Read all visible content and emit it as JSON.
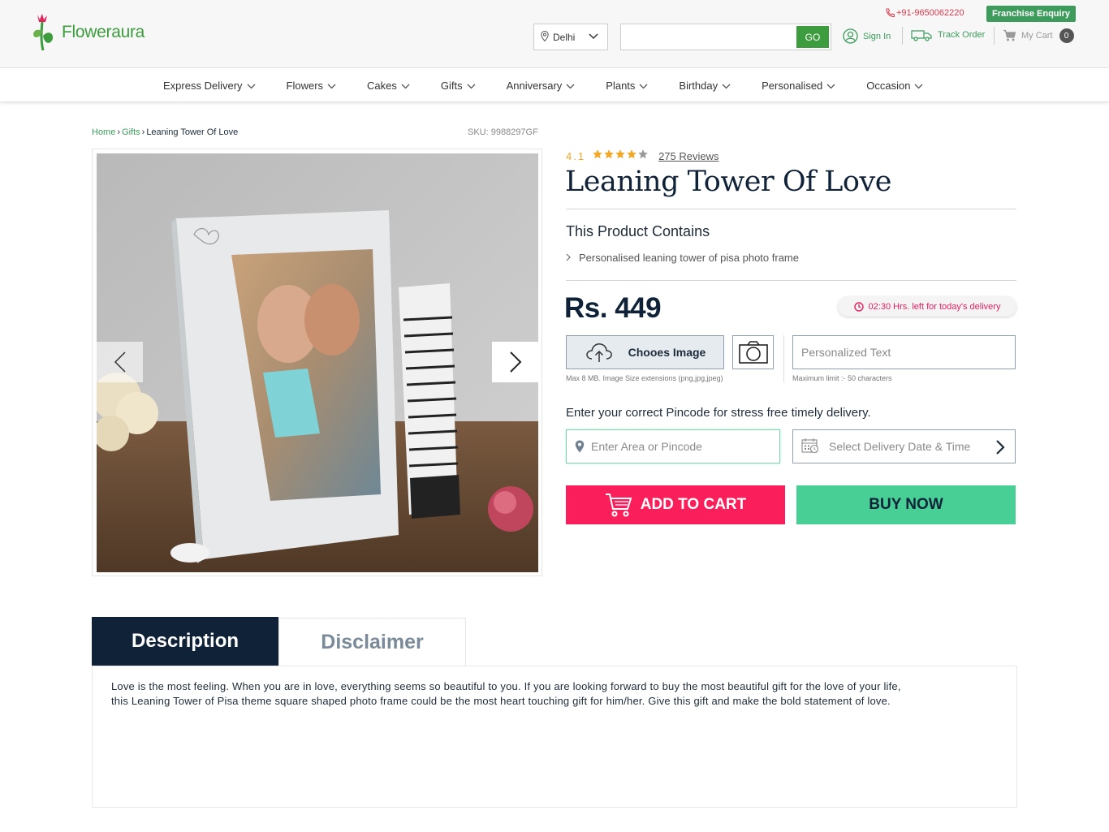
{
  "header": {
    "brand": {
      "part1": "Flower",
      "part2": "aura"
    },
    "city": "Delhi",
    "search": {
      "placeholder": "",
      "button": "GO"
    },
    "phone": "+91-9650062220",
    "franchise": "Franchise Enquiry",
    "signin": "Sign In",
    "track": "Track Order",
    "cart": {
      "label": "My Cart",
      "count": "0"
    }
  },
  "nav": {
    "items": [
      "Express Delivery",
      "Flowers",
      "Cakes",
      "Gifts",
      "Anniversary",
      "Plants",
      "Birthday",
      "Personalised",
      "Occasion"
    ]
  },
  "breadcrumb": {
    "home": "Home",
    "category": "Gifts",
    "current": "Leaning Tower Of Love"
  },
  "sku": "SKU: 9988297GF",
  "product": {
    "rating": "4.1",
    "rating_value": 4.1,
    "rating_max": 5,
    "reviews": "275 Reviews",
    "title": "Leaning Tower Of Love",
    "contains_heading": "This Product Contains",
    "contains_items": [
      "Personalised leaning tower of pisa photo frame"
    ],
    "price": "Rs. 449",
    "delivery_timer": "02:30 Hrs. left for today's delivery"
  },
  "personalise": {
    "choose_image": "Chooes Image",
    "image_hint": "Max 8 MB. Image Size extensions (png,jpg,jpeg)",
    "text_placeholder": "Personalized Text",
    "text_hint": "Maximum limit :- 50 characters"
  },
  "delivery": {
    "note": "Enter your correct Pincode for stress free timely delivery.",
    "pincode_placeholder": "Enter Area or Pincode",
    "date_placeholder": "Select Delivery Date & Time"
  },
  "actions": {
    "add_to_cart": "ADD TO CART",
    "buy_now": "BUY NOW"
  },
  "tabs": {
    "description": "Description",
    "disclaimer": "Disclaimer",
    "description_text": "Love is the most feeling. When you are in love, everything seems so beautiful to you. If you are looking forward to buy the most beautiful gift for the love of your life, this Leaning Tower of Pisa theme square shaped photo frame could be the most heart touching gift for him/her. Give this gift and make the bold statement of love."
  },
  "colors": {
    "brand_green": "#3d9c3d",
    "navy": "#0f2238",
    "add_to_cart": "#fa1f5a",
    "buy_now": "#48cf95",
    "star": "#f5a623",
    "timer_text": "#e91e63"
  }
}
